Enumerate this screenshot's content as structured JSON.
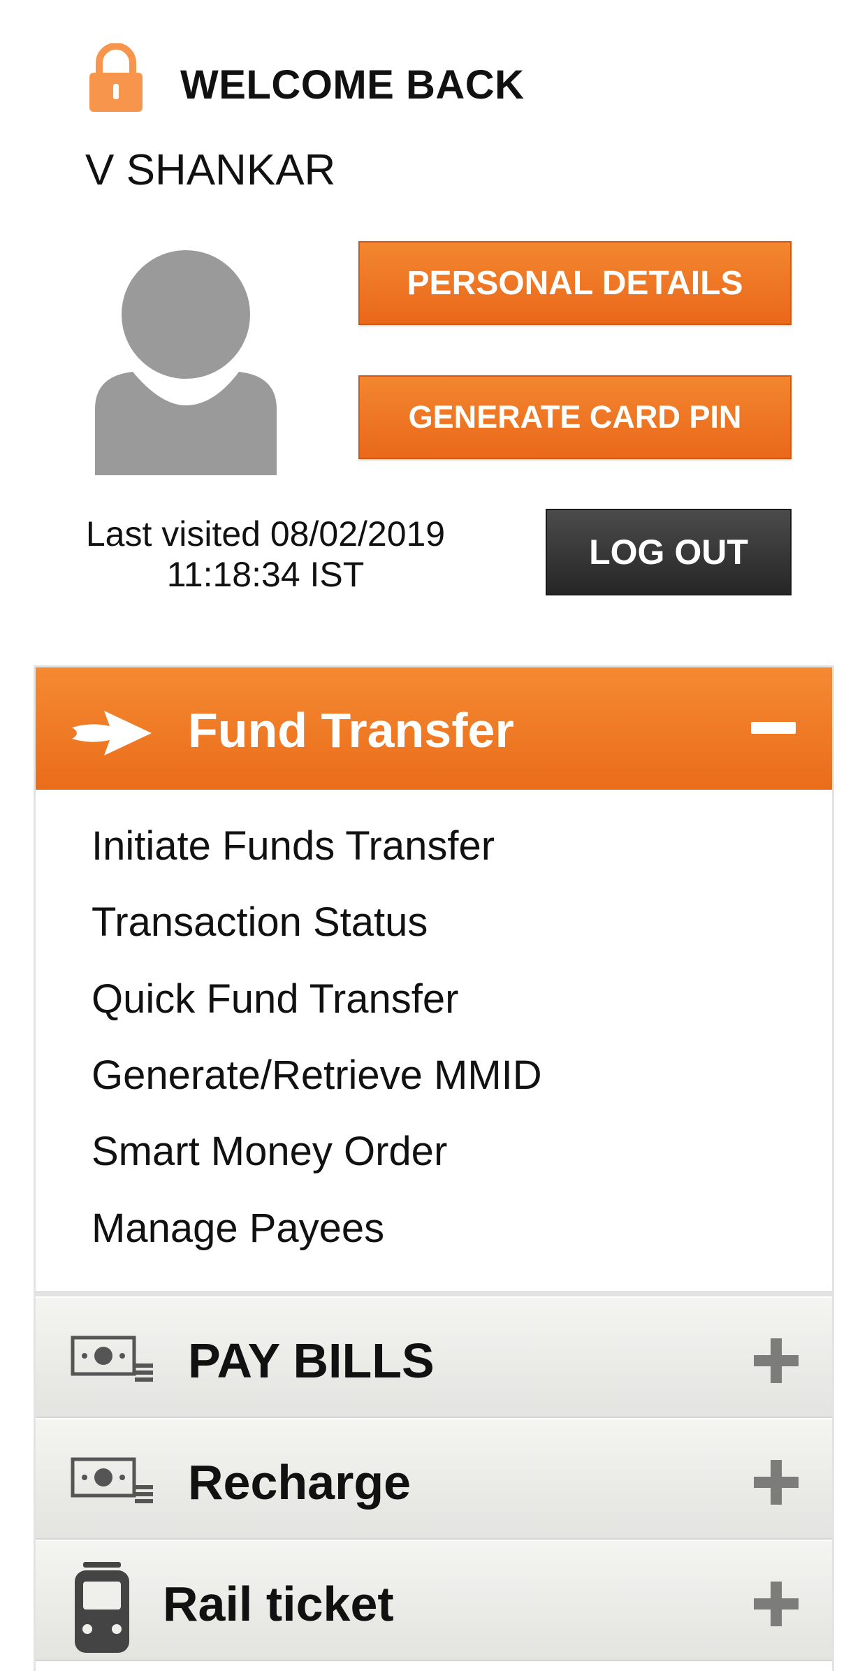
{
  "header": {
    "welcome": "WELCOME BACK",
    "user_name": "V SHANKAR"
  },
  "buttons": {
    "personal_details": "PERSONAL DETAILS",
    "generate_card_pin": "GENERATE CARD PIN",
    "log_out": "LOG OUT"
  },
  "last_visited": {
    "line1": "Last visited 08/02/2019",
    "line2": "11:18:34 IST"
  },
  "menu": {
    "fund_transfer": {
      "title": "Fund Transfer",
      "icon": "arrow-right-icon",
      "expanded": true,
      "items": [
        "Initiate Funds Transfer",
        "Transaction Status",
        "Quick Fund Transfer",
        "Generate/Retrieve MMID",
        "Smart Money Order",
        "Manage Payees"
      ]
    },
    "pay_bills": {
      "title": "PAY BILLS",
      "icon": "money-bill-icon",
      "expanded": false
    },
    "recharge": {
      "title": "Recharge",
      "icon": "money-bill-icon",
      "expanded": false
    },
    "rail_ticket": {
      "title": "Rail ticket",
      "icon": "train-icon",
      "expanded": false
    }
  },
  "colors": {
    "accent_orange": "#ec6f1e",
    "logout_dark": "#333333",
    "avatar_gray": "#9a9a9a"
  }
}
